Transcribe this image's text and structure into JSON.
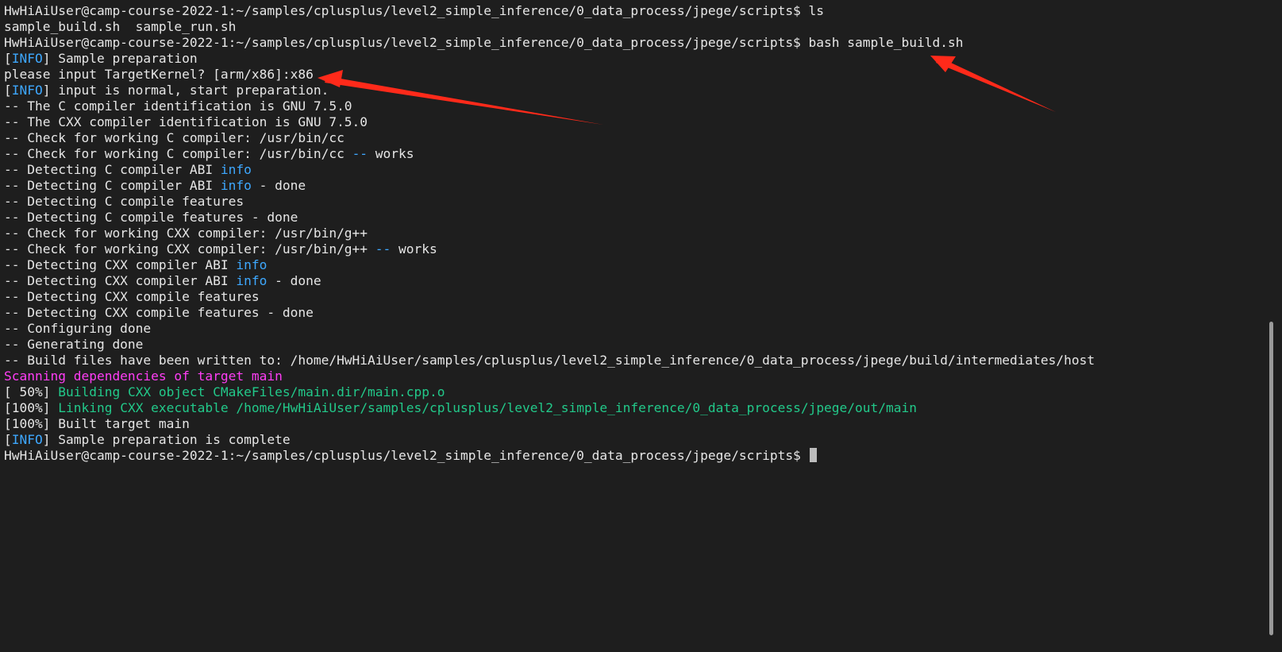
{
  "terminal": {
    "lines": [
      [
        {
          "t": "HwHiAiUser@camp-course-2022-1:~/samples/cplusplus/level2_simple_inference/0_data_process/jpege/scripts$ ls",
          "c": "default"
        }
      ],
      [
        {
          "t": "sample_build.sh  sample_run.sh",
          "c": "default"
        }
      ],
      [
        {
          "t": "HwHiAiUser@camp-course-2022-1:~/samples/cplusplus/level2_simple_inference/0_data_process/jpege/scripts$ bash sample_build.sh",
          "c": "default"
        }
      ],
      [
        {
          "t": "[",
          "c": "default"
        },
        {
          "t": "INFO",
          "c": "info"
        },
        {
          "t": "] Sample preparation",
          "c": "default"
        }
      ],
      [
        {
          "t": "please input TargetKernel? [arm/x86]:x86",
          "c": "default"
        }
      ],
      [
        {
          "t": "[",
          "c": "default"
        },
        {
          "t": "INFO",
          "c": "info"
        },
        {
          "t": "] input is normal, start preparation.",
          "c": "default"
        }
      ],
      [
        {
          "t": "-- The C compiler identification is GNU 7.5.0",
          "c": "default"
        }
      ],
      [
        {
          "t": "-- The CXX compiler identification is GNU 7.5.0",
          "c": "default"
        }
      ],
      [
        {
          "t": "-- Check for working C compiler: /usr/bin/cc",
          "c": "default"
        }
      ],
      [
        {
          "t": "-- Check for working C compiler: /usr/bin/cc ",
          "c": "default"
        },
        {
          "t": "--",
          "c": "info"
        },
        {
          "t": " works",
          "c": "default"
        }
      ],
      [
        {
          "t": "-- Detecting C compiler ABI ",
          "c": "default"
        },
        {
          "t": "info",
          "c": "info"
        }
      ],
      [
        {
          "t": "-- Detecting C compiler ABI ",
          "c": "default"
        },
        {
          "t": "info",
          "c": "info"
        },
        {
          "t": " - done",
          "c": "default"
        }
      ],
      [
        {
          "t": "-- Detecting C compile features",
          "c": "default"
        }
      ],
      [
        {
          "t": "-- Detecting C compile features - done",
          "c": "default"
        }
      ],
      [
        {
          "t": "-- Check for working CXX compiler: /usr/bin/g++",
          "c": "default"
        }
      ],
      [
        {
          "t": "-- Check for working CXX compiler: /usr/bin/g++ ",
          "c": "default"
        },
        {
          "t": "--",
          "c": "info"
        },
        {
          "t": " works",
          "c": "default"
        }
      ],
      [
        {
          "t": "-- Detecting CXX compiler ABI ",
          "c": "default"
        },
        {
          "t": "info",
          "c": "info"
        }
      ],
      [
        {
          "t": "-- Detecting CXX compiler ABI ",
          "c": "default"
        },
        {
          "t": "info",
          "c": "info"
        },
        {
          "t": " - done",
          "c": "default"
        }
      ],
      [
        {
          "t": "-- Detecting CXX compile features",
          "c": "default"
        }
      ],
      [
        {
          "t": "-- Detecting CXX compile features - done",
          "c": "default"
        }
      ],
      [
        {
          "t": "-- Configuring done",
          "c": "default"
        }
      ],
      [
        {
          "t": "-- Generating done",
          "c": "default"
        }
      ],
      [
        {
          "t": "-- Build files have been written to: /home/HwHiAiUser/samples/cplusplus/level2_simple_inference/0_data_process/jpege/build/intermediates/host",
          "c": "default"
        }
      ],
      [
        {
          "t": "Scanning dependencies of target main",
          "c": "magenta"
        }
      ],
      [
        {
          "t": "[ 50%] ",
          "c": "default"
        },
        {
          "t": "Building CXX object CMakeFiles/main.dir/main.cpp.o",
          "c": "green"
        }
      ],
      [
        {
          "t": "[100%] ",
          "c": "default"
        },
        {
          "t": "Linking CXX executable /home/HwHiAiUser/samples/cplusplus/level2_simple_inference/0_data_process/jpege/out/main",
          "c": "green"
        }
      ],
      [
        {
          "t": "[100%] Built target main",
          "c": "default"
        }
      ],
      [
        {
          "t": "[",
          "c": "default"
        },
        {
          "t": "INFO",
          "c": "info"
        },
        {
          "t": "] Sample preparation is complete",
          "c": "default"
        }
      ],
      [
        {
          "t": "HwHiAiUser@camp-course-2022-1:~/samples/cplusplus/level2_simple_inference/0_data_process/jpege/scripts$ ",
          "c": "default"
        }
      ]
    ],
    "cursor_line": 28
  },
  "colors": {
    "background": "#1e1e1e",
    "text": "#e6e6e6",
    "info": "#3ea8ff",
    "magenta": "#ff3df5",
    "green": "#22c98a",
    "arrow": "#ff2a1a"
  }
}
